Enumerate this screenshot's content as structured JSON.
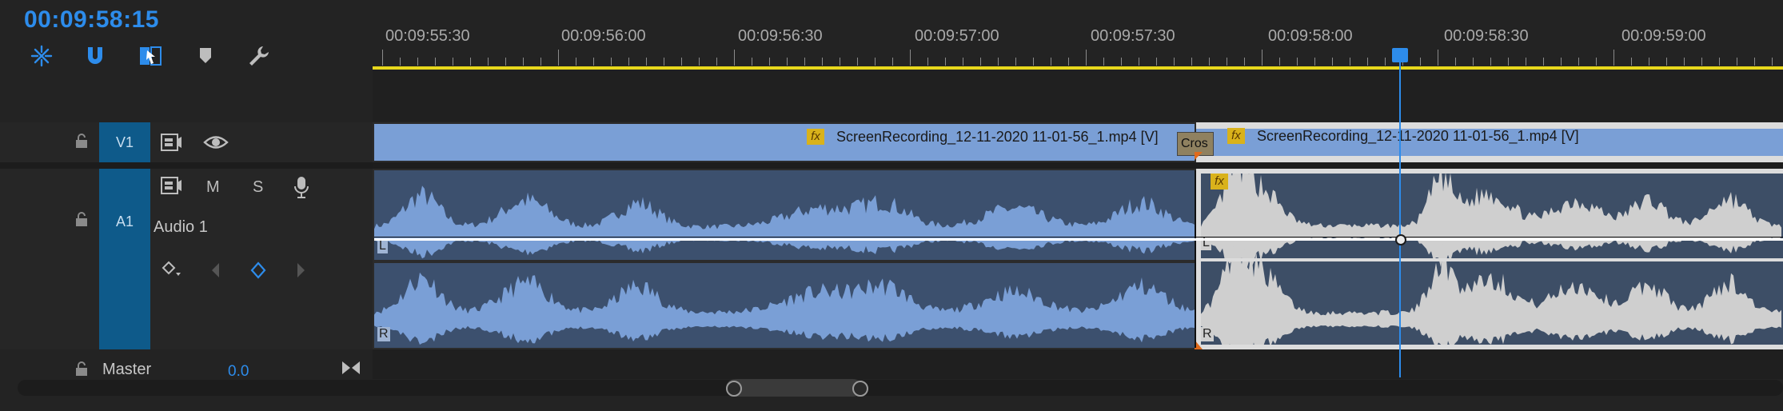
{
  "timeline": {
    "timecode": "00:09:58:15",
    "ruler_labels": [
      "00:09:55:30",
      "00:09:56:00",
      "00:09:56:30",
      "00:09:57:00",
      "00:09:57:30",
      "00:09:58:00",
      "00:09:58:30",
      "00:09:59:00"
    ]
  },
  "tools": [
    {
      "name": "snap-in-sequence-icon"
    },
    {
      "name": "magnet-icon"
    },
    {
      "name": "linked-selection-icon"
    },
    {
      "name": "marker-icon"
    },
    {
      "name": "wrench-icon"
    }
  ],
  "tracks": {
    "v1": {
      "label": "V1"
    },
    "a1": {
      "label": "A1",
      "name": "Audio 1",
      "mute": "M",
      "solo": "S"
    },
    "master": {
      "label": "Master",
      "value": "0.0"
    }
  },
  "clips": {
    "video_left": "ScreenRecording_12-11-2020 11-01-56_1.mp4 [V]",
    "video_right": "ScreenRecording_12-11-2020 11-01-56_1.mp4 [V]",
    "transition": "Cros",
    "fx": "fx",
    "channel_l": "L",
    "channel_r": "R"
  },
  "colors": {
    "accent": "#2d8ceb",
    "video_clip": "#7a9fd6",
    "audio_clip_left": "#3c506e",
    "audio_clip_right": "#3d4e66",
    "work_area": "#e8d81c",
    "track_tag": "#0e5a8a"
  }
}
